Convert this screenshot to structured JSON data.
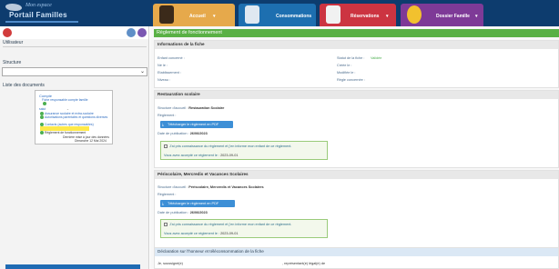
{
  "logo": {
    "line1": "Mon espace",
    "line2": "Portail Familles"
  },
  "nav": {
    "tabs": [
      {
        "label": "Accueil"
      },
      {
        "label": "Consommations"
      },
      {
        "label": "Réservations"
      },
      {
        "label": "Dossier Famille"
      }
    ]
  },
  "sidebar": {
    "utilisateur_label": "Utilisateur",
    "structure_label": "Structure",
    "structure_value": "",
    "documents_label": "Liste des documents",
    "docs": {
      "compte_label": "Compte",
      "compte_items": [
        "Fiche responsable compte famille"
      ],
      "sub_label": "salut",
      "items": [
        "Assurance scolaire et extra-scolaire",
        "Autorisations parentales et questions diverses",
        "Contacts (autres que responsables)",
        "Fiche médicale enfant",
        "Règlement de fonctionnement"
      ],
      "footer1": "Dernière mise à jour des données",
      "footer2": "Dimanche 12 Mai 2024"
    }
  },
  "main": {
    "title": "Règlement de fonctionnement",
    "info": {
      "title": "Informations de la fiche",
      "enfant_label": "Enfant concerné :",
      "ne_label": "Né le :",
      "etab_label": "Etablissement :",
      "niveau_label": "Niveau :",
      "statut_label": "Statut de la fiche :",
      "statut_value": "Validée",
      "cree_label": "Créée le :",
      "modif_label": "Modifiée le :",
      "regle_label": "Règle concernée :"
    },
    "resto": {
      "title": "Restauration scolaire",
      "structure_label": "Structure d'accueil :",
      "structure_value": "Restauration Scolaire",
      "reglement_label": "Règlement :",
      "button_label": "Télécharger le règlement en PDF",
      "date_label": "Date de publication :",
      "date_value": "26/06/2023",
      "accept_text": "J'ai pris connaissance du règlement et j'en informe mon enfant de ce règlement.",
      "accepted_label": "Vous avez accepté ce règlement le :",
      "accepted_value": "2023-09-01"
    },
    "peri": {
      "title": "Périscolaire, Mercredis et Vacances Scolaires",
      "structure_label": "Structure d'accueil :",
      "structure_value": "Périscolaire, Mercredis et Vacances Scolaires",
      "reglement_label": "Règlement :",
      "button_label": "Télécharger le règlement en PDF",
      "date_label": "Date de publication :",
      "date_value": "26/06/2023",
      "accept_text": "J'ai pris connaissance du règlement et j'en informe mon enfant de ce règlement.",
      "accepted_label": "Vous avez accepté ce règlement le :",
      "accepted_value": "2023-09-01"
    },
    "decl": {
      "title": "Déclaration sur l'honneur et téléconsommation de la fiche",
      "line_a": "Je, soussigné(e)",
      "line_b": ", représentant(e) légal(e) de"
    }
  },
  "colors": {
    "topbar": "#0d3c6e",
    "accueil": "#e6a94b",
    "consommations": "#1d6fb0",
    "reservations": "#cc3441",
    "dossier": "#7e3a97",
    "title_green": "#59b045",
    "button_blue": "#3d8fd6"
  }
}
